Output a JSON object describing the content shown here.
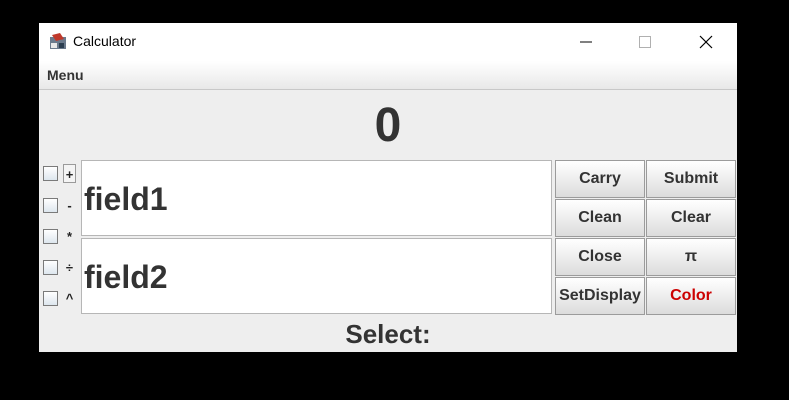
{
  "window": {
    "title": "Calculator"
  },
  "menubar": {
    "menu": "Menu"
  },
  "display": {
    "value": "0"
  },
  "operators": [
    "+",
    "-",
    "*",
    "÷",
    "^"
  ],
  "fields": {
    "field1": "field1",
    "field2": "field2"
  },
  "buttons": {
    "carry": "Carry",
    "submit": "Submit",
    "clean": "Clean",
    "clear": "Clear",
    "close": "Close",
    "pi": "π",
    "setdisplay": "SetDisplay",
    "color": "Color"
  },
  "select_label": "Select:",
  "colors": {
    "color_button_text": "#cc0000",
    "background": "#eeeeee"
  }
}
